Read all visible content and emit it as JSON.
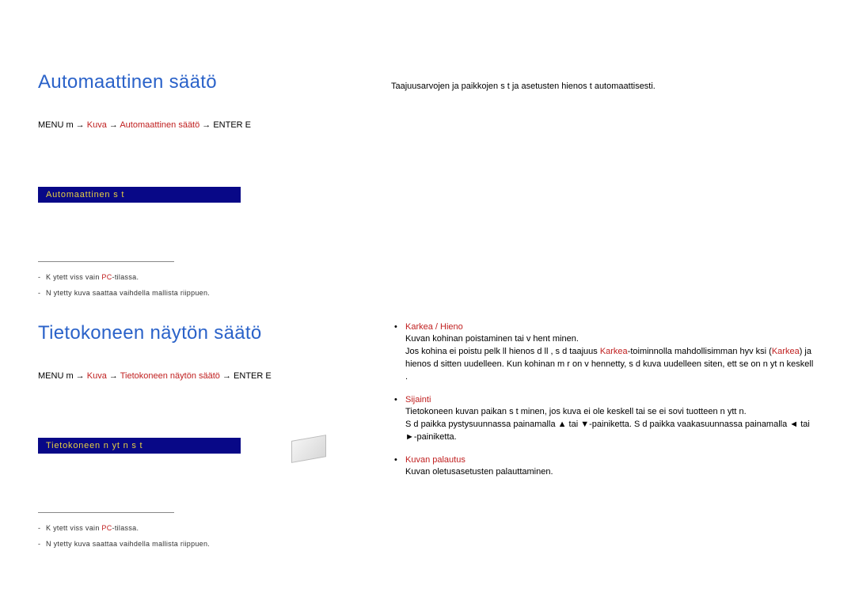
{
  "section1": {
    "heading": "Automaattinen säätö",
    "path": {
      "p1": "MENU m → ",
      "r1": "Kuva",
      "p2": " → ",
      "r2": "Automaattinen säätö",
      "p3": " → ENTER E"
    },
    "box_label": "Automaattinen s  t",
    "note1_a": "K ytett viss  vain ",
    "note1_pc": "PC",
    "note1_b": "-tilassa.",
    "note2": "N ytetty kuva saattaa vaihdella mallista riippuen.",
    "right_text": "Taajuusarvojen ja paikkojen s  t  ja asetusten hienos  t  automaattisesti."
  },
  "section2": {
    "heading": "Tietokoneen näytön säätö",
    "path": {
      "p1": "MENU m → ",
      "r1": "Kuva",
      "p2": " → ",
      "r2": "Tietokoneen näytön säätö",
      "p3": " → ENTER E"
    },
    "box_label": "Tietokoneen n yt n s  t",
    "note1_a": "K ytett viss  vain ",
    "note1_pc": "PC",
    "note1_b": "-tilassa.",
    "note2": "N ytetty kuva saattaa vaihdella mallista riippuen.",
    "items": {
      "i1": {
        "title": "Karkea / Hieno",
        "line1": "Kuvan kohinan poistaminen tai v hent minen.",
        "line2_a": "Jos kohina ei poistu pelk ll  hienos d ll , s  d  taajuus ",
        "line2_r1": "Karkea",
        "line2_b": "-toiminnolla mahdollisimman hyv ksi (",
        "line2_r2": "Karkea",
        "line2_c": ") ja hienos d  sitten uudelleen. Kun kohinan m  r  on v hennetty, s  d  kuva uudelleen siten, ett  se on n yt n keskell ."
      },
      "i2": {
        "title": "Sijainti",
        "line1": "Tietokoneen kuvan paikan s  t minen, jos kuva ei ole keskell  tai se ei sovi tuotteen n ytt  n.",
        "line2": "S  d  paikka pystysuunnassa painamalla ▲ tai ▼-painiketta. S  d  paikka vaakasuunnassa painamalla ◄ tai ►-painiketta."
      },
      "i3": {
        "title": "Kuvan palautus",
        "line1": "Kuvan oletusasetusten palauttaminen."
      }
    }
  }
}
